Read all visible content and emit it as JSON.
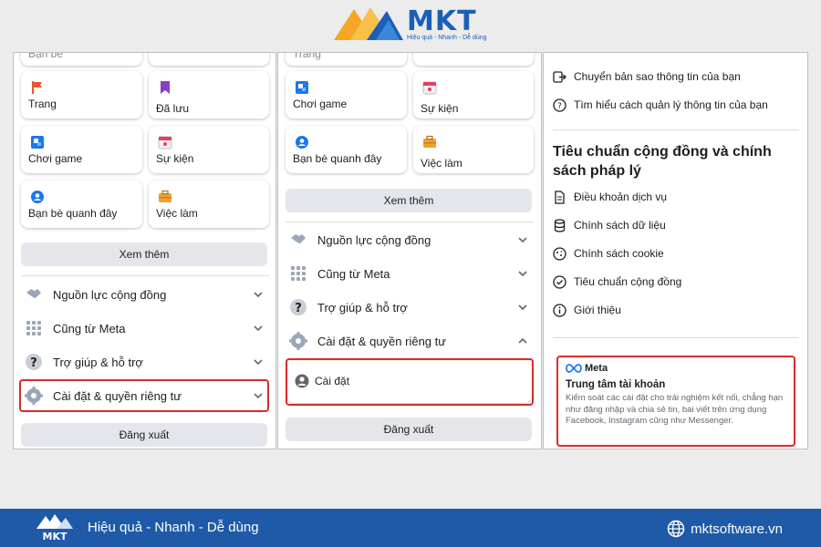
{
  "brand": {
    "name": "MKT",
    "sub": "Hiệu quả - Nhanh - Dễ dùng"
  },
  "panel1": {
    "top_partial": "Bạn bè",
    "cards": [
      {
        "label": "Trang",
        "icon": "flag-icon"
      },
      {
        "label": "Đã lưu",
        "icon": "bookmark-icon"
      },
      {
        "label": "Chơi game",
        "icon": "game-icon"
      },
      {
        "label": "Sự kiện",
        "icon": "calendar-icon"
      },
      {
        "label": "Bạn bè quanh đây",
        "icon": "location-icon"
      },
      {
        "label": "Việc làm",
        "icon": "briefcase-icon"
      }
    ],
    "see_more": "Xem thêm",
    "menu": [
      {
        "label": "Nguồn lực cộng đồng",
        "icon": "handshake-icon"
      },
      {
        "label": "Cũng từ Meta",
        "icon": "grid-icon"
      },
      {
        "label": "Trợ giúp & hỗ trợ",
        "icon": "help-icon"
      },
      {
        "label": "Cài đặt & quyền riêng tư",
        "icon": "gear-icon"
      }
    ],
    "logout": "Đăng xuất"
  },
  "panel2": {
    "top_partial": "Trang",
    "cards": [
      {
        "label": "Chơi game",
        "icon": "game-icon"
      },
      {
        "label": "Sự kiện",
        "icon": "calendar-icon"
      },
      {
        "label": "Bạn bè quanh đây",
        "icon": "location-icon"
      },
      {
        "label": "Việc làm",
        "icon": "briefcase-icon"
      }
    ],
    "see_more": "Xem thêm",
    "menu": [
      {
        "label": "Nguồn lực cộng đồng",
        "icon": "handshake-icon"
      },
      {
        "label": "Cũng từ Meta",
        "icon": "grid-icon"
      },
      {
        "label": "Trợ giúp & hỗ trợ",
        "icon": "help-icon"
      },
      {
        "label": "Cài đặt & quyền riêng tư",
        "icon": "gear-icon"
      }
    ],
    "settings_item": "Cài đặt",
    "logout": "Đăng xuất"
  },
  "panel3": {
    "top_items": [
      {
        "label": "Chuyển bản sao thông tin của bạn",
        "icon": "transfer-icon"
      },
      {
        "label": "Tìm hiểu cách quản lý thông tin của bạn",
        "icon": "question-icon"
      }
    ],
    "section_title": "Tiêu chuẩn cộng đồng và chính sách pháp lý",
    "policy_items": [
      {
        "label": "Điều khoản dịch vụ",
        "icon": "document-icon"
      },
      {
        "label": "Chính sách dữ liệu",
        "icon": "database-icon"
      },
      {
        "label": "Chính sách cookie",
        "icon": "cookie-icon"
      },
      {
        "label": "Tiêu chuẩn cộng đồng",
        "icon": "check-circle-icon"
      },
      {
        "label": "Giới thiệu",
        "icon": "info-icon"
      }
    ],
    "meta_card": {
      "logo": "Meta",
      "title": "Trung tâm tài khoản",
      "description": "Kiểm soát các cài đặt cho trải nghiệm kết nối, chẳng hạn như đăng nhập và chia sẻ tin, bài viết trên ứng dụng Facebook, Instagram cũng như Messenger."
    }
  },
  "footer": {
    "tagline": "Hiệu quả - Nhanh - Dễ dùng",
    "website": "mktsoftware.vn"
  },
  "colors": {
    "highlight": "#d92b2b",
    "footer_bg": "#1f5aa8",
    "brand_blue": "#1b5fb8",
    "brand_orange": "#f5a623"
  }
}
